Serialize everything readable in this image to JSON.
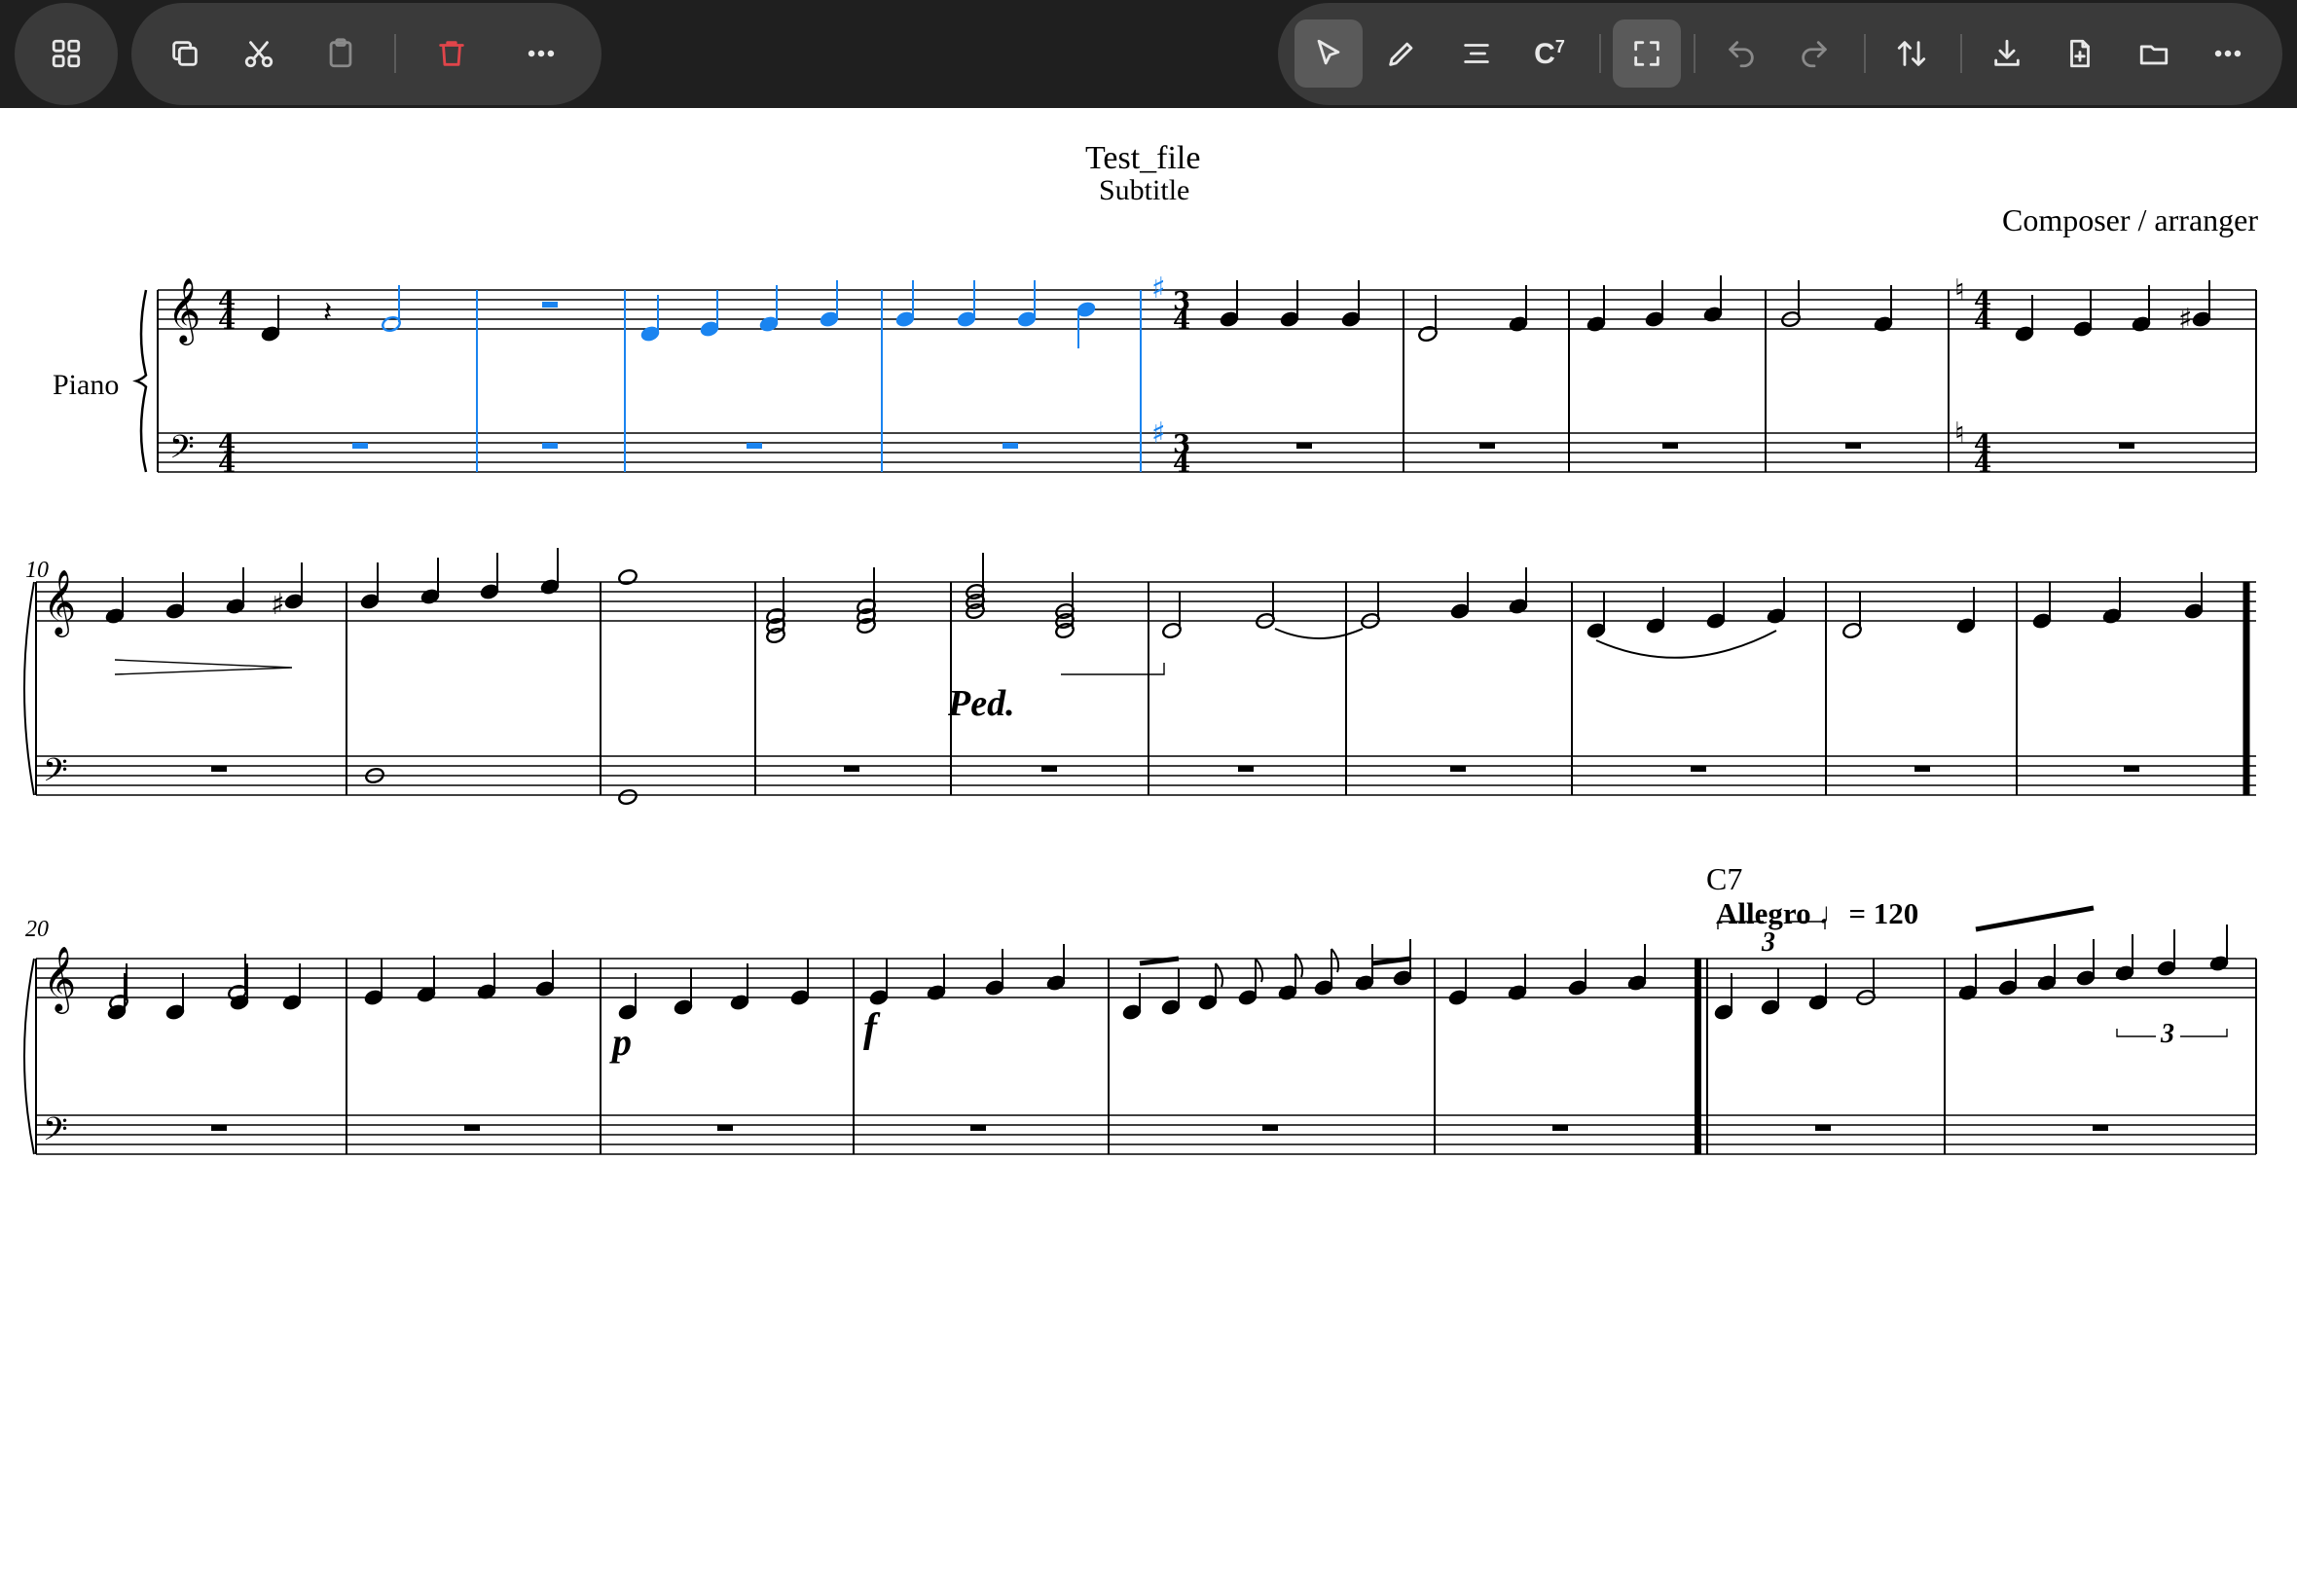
{
  "colors": {
    "toolbar_bg": "#1f1f1f",
    "pill_bg": "#3a3a3a",
    "active_bg": "#5a5a5a",
    "icon": "#e8e8e8",
    "icon_disabled": "#8a8a8a",
    "delete": "#e0454a",
    "selection": "#1a84f0",
    "notation": "#000000"
  },
  "toolbar": {
    "left_buttons": [
      {
        "icon": "grid-icon",
        "label": ""
      },
      {
        "icon": "copy-icon",
        "label": ""
      },
      {
        "icon": "cut-icon",
        "label": ""
      },
      {
        "icon": "paste-icon",
        "label": ""
      },
      {
        "icon": "delete-icon",
        "label": ""
      },
      {
        "icon": "more-icon",
        "label": ""
      }
    ],
    "right_buttons": [
      {
        "icon": "select-cursor-icon",
        "label": ""
      },
      {
        "icon": "pencil-icon",
        "label": ""
      },
      {
        "icon": "align-icon",
        "label": ""
      },
      {
        "icon": "chord-symbol-icon",
        "label": "C",
        "sup": "7"
      },
      {
        "icon": "fullscreen-icon",
        "label": ""
      },
      {
        "icon": "undo-icon",
        "label": ""
      },
      {
        "icon": "redo-icon",
        "label": ""
      },
      {
        "icon": "sort-icon",
        "label": ""
      },
      {
        "icon": "download-icon",
        "label": ""
      },
      {
        "icon": "new-file-icon",
        "label": ""
      },
      {
        "icon": "folder-icon",
        "label": ""
      },
      {
        "icon": "more-icon",
        "label": ""
      }
    ]
  },
  "score": {
    "title": "Test_file",
    "subtitle": "Subtitle",
    "composer": "Composer / arranger",
    "instrument": "Piano",
    "measure_numbers": [
      "10",
      "20"
    ],
    "chord_symbol": "C7",
    "tempo_text": "Allegro",
    "tempo_value": "= 120",
    "tuplet_number": "3",
    "dynamics": [
      "p",
      "f"
    ],
    "pedal_mark": "Ped."
  }
}
